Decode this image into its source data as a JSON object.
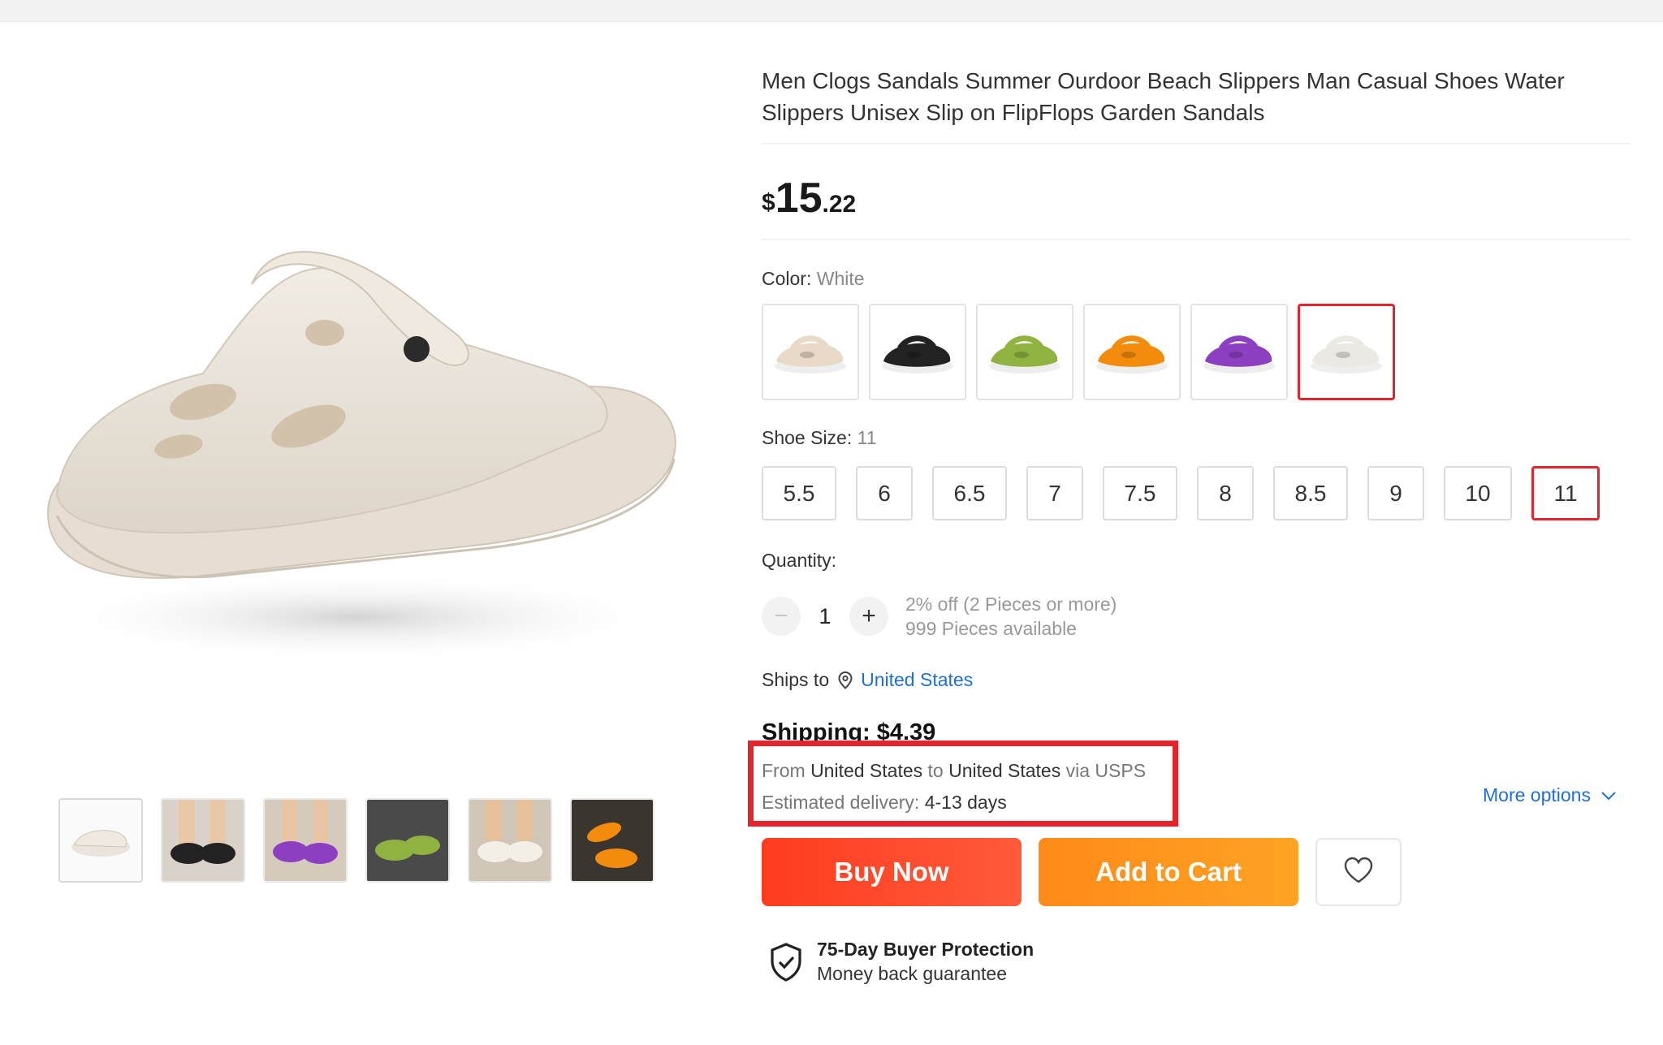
{
  "product": {
    "title": "Men Clogs Sandals Summer Ourdoor Beach Slippers Man Casual Shoes Water Slippers Unisex Slip on FlipFlops Garden Sandals",
    "price": {
      "currency": "$",
      "integer": "15",
      "decimal": ".22"
    }
  },
  "color": {
    "label": "Color:",
    "selected": "White",
    "options": [
      {
        "name": "beige",
        "hex": "#e9d9c8"
      },
      {
        "name": "black",
        "hex": "#222222"
      },
      {
        "name": "green",
        "hex": "#8fb240"
      },
      {
        "name": "orange",
        "hex": "#f38b0c"
      },
      {
        "name": "purple",
        "hex": "#8d3fc2"
      },
      {
        "name": "white",
        "hex": "#ebe9e4"
      }
    ]
  },
  "size": {
    "label": "Shoe Size:",
    "selected": "11",
    "options": [
      "5.5",
      "6",
      "6.5",
      "7",
      "7.5",
      "8",
      "8.5",
      "9",
      "10",
      "11"
    ]
  },
  "quantity": {
    "label": "Quantity:",
    "value": "1",
    "minus": "−",
    "plus": "+",
    "discount": "2% off (2 Pieces or more)",
    "available": "999 Pieces available"
  },
  "ships": {
    "label": "Ships to",
    "country": "United States"
  },
  "shipping": {
    "title": "Shipping: $4.39",
    "from_word": "From",
    "from": "United States",
    "to_word": "to",
    "to": "United States",
    "via": "via USPS",
    "delivery_label": "Estimated delivery:",
    "delivery_days": "4-13 days",
    "more_options": "More options"
  },
  "actions": {
    "buy_now": "Buy Now",
    "add_to_cart": "Add to Cart"
  },
  "protection": {
    "title": "75-Day Buyer Protection",
    "subtitle": "Money back guarantee"
  },
  "colors": {
    "accent_red": "#e3242b",
    "link_blue": "#1f6fd6",
    "buy_orange": "#ff4b2b",
    "cart_orange": "#ff9a1e"
  }
}
